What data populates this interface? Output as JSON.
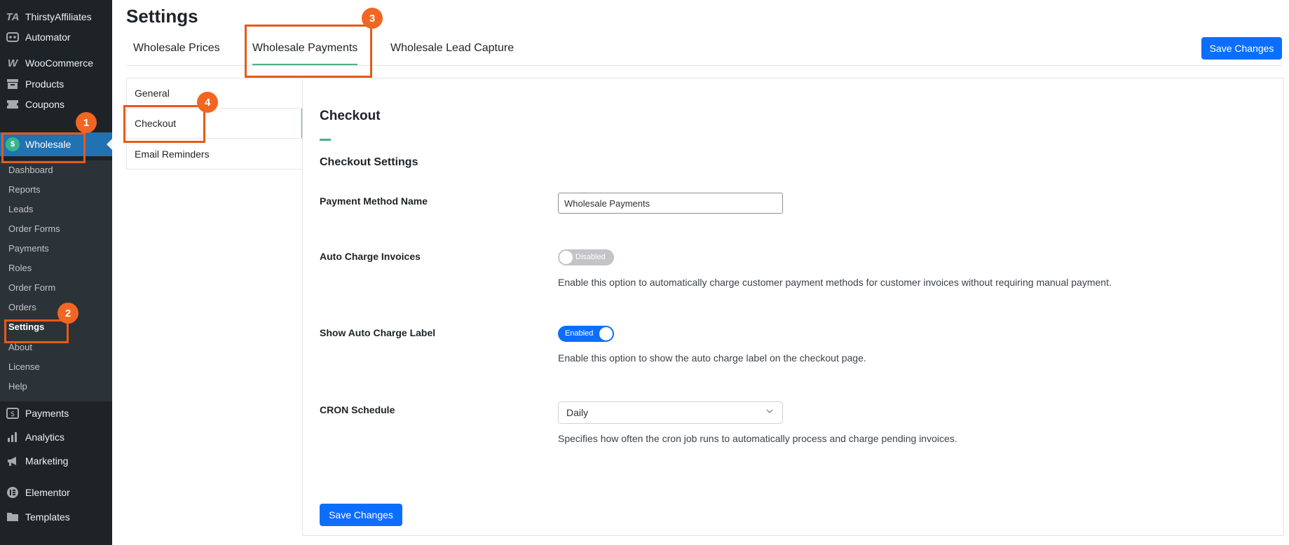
{
  "sidebar": {
    "top_items": [
      {
        "label": "ThirstyAffiliates",
        "icon": "thirstyaffiliates-icon"
      },
      {
        "label": "Automator",
        "icon": "automator-icon"
      },
      {
        "label": "WooCommerce",
        "icon": "woocommerce-icon"
      },
      {
        "label": "Products",
        "icon": "products-icon"
      },
      {
        "label": "Coupons",
        "icon": "coupons-icon"
      },
      {
        "label": "Wholesale",
        "icon": "wholesale-icon"
      }
    ],
    "submenu": [
      "Dashboard",
      "Reports",
      "Leads",
      "Order Forms",
      "Payments",
      "Roles",
      "Order Form",
      "Orders",
      "Settings",
      "About",
      "License",
      "Help"
    ],
    "bottom_items": [
      {
        "label": "Payments",
        "icon": "payments-icon"
      },
      {
        "label": "Analytics",
        "icon": "analytics-icon"
      },
      {
        "label": "Marketing",
        "icon": "marketing-icon"
      },
      {
        "label": "Elementor",
        "icon": "elementor-icon"
      },
      {
        "label": "Templates",
        "icon": "templates-icon"
      }
    ]
  },
  "page": {
    "title": "Settings"
  },
  "tabs": [
    {
      "label": "Wholesale Prices",
      "active": false
    },
    {
      "label": "Wholesale Payments",
      "active": true
    },
    {
      "label": "Wholesale Lead Capture",
      "active": false
    }
  ],
  "save_top_label": "Save Changes",
  "side_tabs": [
    {
      "label": "General",
      "active": false
    },
    {
      "label": "Checkout",
      "active": true
    },
    {
      "label": "Email Reminders",
      "active": false
    }
  ],
  "panel": {
    "title": "Checkout",
    "subtitle": "Checkout Settings",
    "payment_method_name": {
      "label": "Payment Method Name",
      "value": "Wholesale Payments"
    },
    "auto_charge": {
      "label": "Auto Charge Invoices",
      "state": "Disabled",
      "help": "Enable this option to automatically charge customer payment methods for customer invoices without requiring manual payment."
    },
    "show_label": {
      "label": "Show Auto Charge Label",
      "state": "Enabled",
      "help": "Enable this option to show the auto charge label on the checkout page."
    },
    "cron": {
      "label": "CRON Schedule",
      "value": "Daily",
      "help": "Specifies how often the cron job runs to automatically process and charge pending invoices."
    },
    "save_label": "Save Changes"
  },
  "annotations": [
    "1",
    "2",
    "3",
    "4"
  ],
  "colors": {
    "accent": "#4caf8a",
    "primary": "#0d6efd",
    "annotation": "#f26522",
    "sidebar_bg": "#1d2327",
    "wp_active": "#2271b1"
  }
}
